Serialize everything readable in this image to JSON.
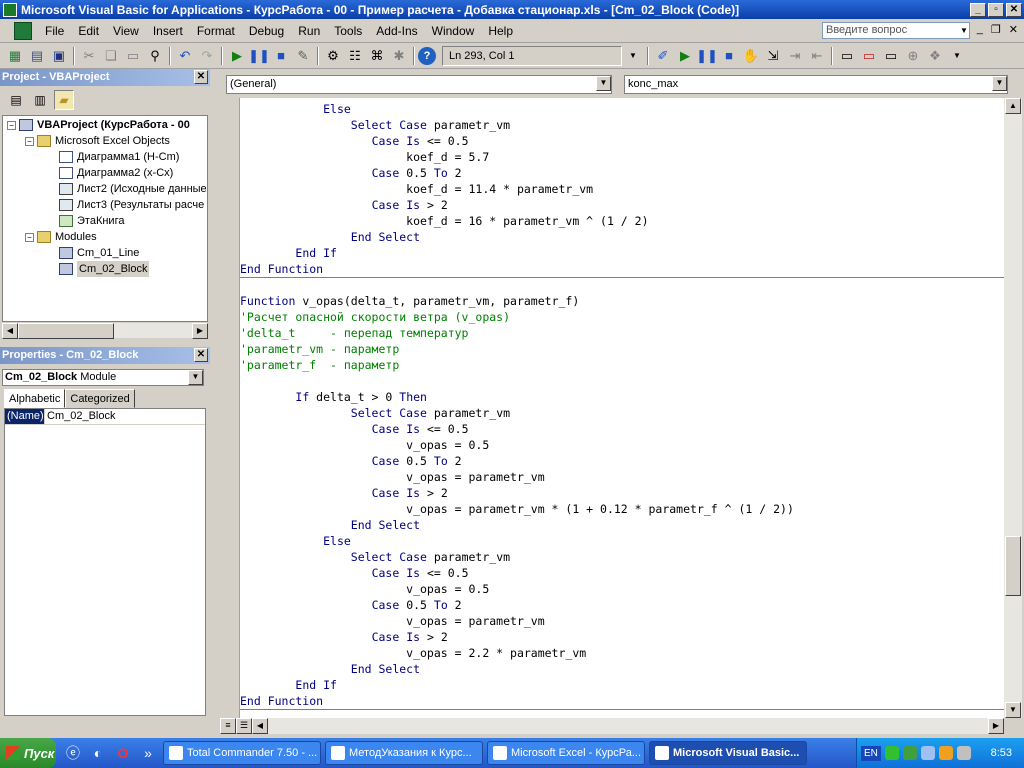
{
  "window": {
    "title": "Microsoft Visual Basic for Applications - КурсРабота - 00 - Пример расчета - Добавка стационар.xls - [Cm_02_Block (Code)]",
    "min_glyph": "_",
    "max_glyph": "▫",
    "close_glyph": "✕"
  },
  "menu": {
    "items": [
      "File",
      "Edit",
      "View",
      "Insert",
      "Format",
      "Debug",
      "Run",
      "Tools",
      "Add-Ins",
      "Window",
      "Help"
    ],
    "ask_placeholder": "Введите вопрос",
    "mdi_min": "_",
    "mdi_restore": "❐",
    "mdi_close": "✕"
  },
  "toolbar": {
    "position": "Ln 293, Col 1"
  },
  "project": {
    "title": "Project - VBAProject",
    "tree": [
      {
        "label": "VBAProject (КурсРабота - 00",
        "icon": "project-icon",
        "bold": true
      },
      {
        "label": "Microsoft Excel Objects",
        "icon": "folder-icon"
      },
      {
        "label": "Диаграмма1 (Н-Cm)",
        "icon": "chart-icon"
      },
      {
        "label": "Диаграмма2 (х-Cх)",
        "icon": "chart-icon"
      },
      {
        "label": "Лист2 (Исходные данные",
        "icon": "sheet-icon"
      },
      {
        "label": "Лист3 (Результаты расче",
        "icon": "sheet-icon"
      },
      {
        "label": "ЭтаКнига",
        "icon": "workbook-icon"
      },
      {
        "label": "Modules",
        "icon": "folder-icon"
      },
      {
        "label": "Cm_01_Line",
        "icon": "module-icon"
      },
      {
        "label": "Cm_02_Block",
        "icon": "module-icon",
        "selected": true
      }
    ]
  },
  "properties": {
    "title": "Properties - Cm_02_Block",
    "object_name": "Cm_02_Block",
    "object_type": "Module",
    "tabs": [
      "Alphabetic",
      "Categorized"
    ],
    "rows": [
      {
        "name": "(Name)",
        "value": "Cm_02_Block"
      }
    ]
  },
  "code": {
    "object_combo": "(General)",
    "proc_combo": "konc_max",
    "lines": [
      "            Else",
      "                Select Case parametr_vm",
      "                   Case Is <= 0.5",
      "                        koef_d = 5.7",
      "                   Case 0.5 To 2",
      "                        koef_d = 11.4 * parametr_vm",
      "                   Case Is > 2",
      "                        koef_d = 16 * parametr_vm ^ (1 / 2)",
      "                End Select",
      "        End If",
      "End Function",
      "",
      "Function v_opas(delta_t, parametr_vm, parametr_f)",
      "'Расчет опасной скорости ветра (v_opas)",
      "'delta_t     - перепад температур",
      "'parametr_vm - параметр",
      "'parametr_f  - параметр",
      "",
      "        If delta_t > 0 Then",
      "                Select Case parametr_vm",
      "                   Case Is <= 0.5",
      "                        v_opas = 0.5",
      "                   Case 0.5 To 2",
      "                        v_opas = parametr_vm",
      "                   Case Is > 2",
      "                        v_opas = parametr_vm * (1 + 0.12 * parametr_f ^ (1 / 2))",
      "                End Select",
      "            Else",
      "                Select Case parametr_vm",
      "                   Case Is <= 0.5",
      "                        v_opas = 0.5",
      "                   Case 0.5 To 2",
      "                        v_opas = parametr_vm",
      "                   Case Is > 2",
      "                        v_opas = 2.2 * parametr_vm",
      "                End Select",
      "        End If",
      "End Function"
    ],
    "keyword_color": "#00007f",
    "comment_color": "#007f00"
  },
  "taskbar": {
    "start_label": "Пуск",
    "quick_more": "»",
    "tasks": [
      {
        "label": "Total Commander 7.50 - ...",
        "active": false
      },
      {
        "label": "МетодУказания к Курс...",
        "active": false
      },
      {
        "label": "Microsoft Excel - КурсРа...",
        "active": false
      },
      {
        "label": "Microsoft Visual Basic...",
        "active": true
      }
    ],
    "lang": "EN",
    "time": "8:53"
  }
}
